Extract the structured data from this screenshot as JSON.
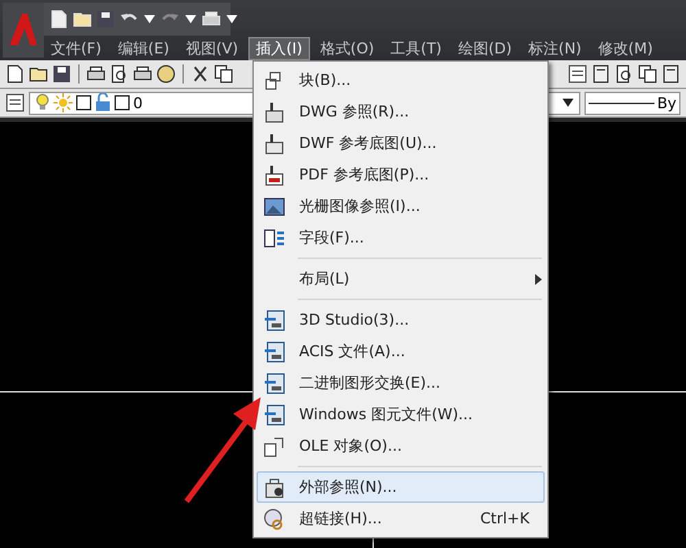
{
  "menu_bar": [
    {
      "label": "文件(F)",
      "selected": false
    },
    {
      "label": "编辑(E)",
      "selected": false
    },
    {
      "label": "视图(V)",
      "selected": false
    },
    {
      "label": "插入(I)",
      "selected": true
    },
    {
      "label": "格式(O)",
      "selected": false
    },
    {
      "label": "工具(T)",
      "selected": false
    },
    {
      "label": "绘图(D)",
      "selected": false
    },
    {
      "label": "标注(N)",
      "selected": false
    },
    {
      "label": "修改(M)",
      "selected": false
    }
  ],
  "layer_toolbar": {
    "layer_name": "0",
    "linetype": "By"
  },
  "insert_menu": {
    "groups": [
      [
        {
          "label": "块(B)...",
          "kind": "block",
          "selected": false
        },
        {
          "label": "DWG 参照(R)...",
          "kind": "dwg",
          "selected": false
        },
        {
          "label": "DWF 参考底图(U)...",
          "kind": "dwf",
          "selected": false
        },
        {
          "label": "PDF 参考底图(P)...",
          "kind": "pdf",
          "selected": false
        },
        {
          "label": "光栅图像参照(I)...",
          "kind": "image",
          "selected": false
        },
        {
          "label": "字段(F)...",
          "kind": "field",
          "selected": false
        }
      ],
      [
        {
          "label": "布局(L)",
          "kind": "submenu",
          "has_submenu": true,
          "selected": false
        }
      ],
      [
        {
          "label": "3D Studio(3)...",
          "kind": "import",
          "selected": false
        },
        {
          "label": "ACIS 文件(A)...",
          "kind": "import",
          "selected": false
        },
        {
          "label": "二进制图形交换(E)...",
          "kind": "import",
          "selected": false
        },
        {
          "label": "Windows 图元文件(W)...",
          "kind": "import",
          "selected": false
        },
        {
          "label": "OLE 对象(O)...",
          "kind": "ole",
          "selected": false
        }
      ],
      [
        {
          "label": "外部参照(N)...",
          "kind": "xref",
          "selected": true
        },
        {
          "label": "超链接(H)...",
          "kind": "link",
          "shortcut": "Ctrl+K",
          "selected": false
        }
      ]
    ]
  }
}
